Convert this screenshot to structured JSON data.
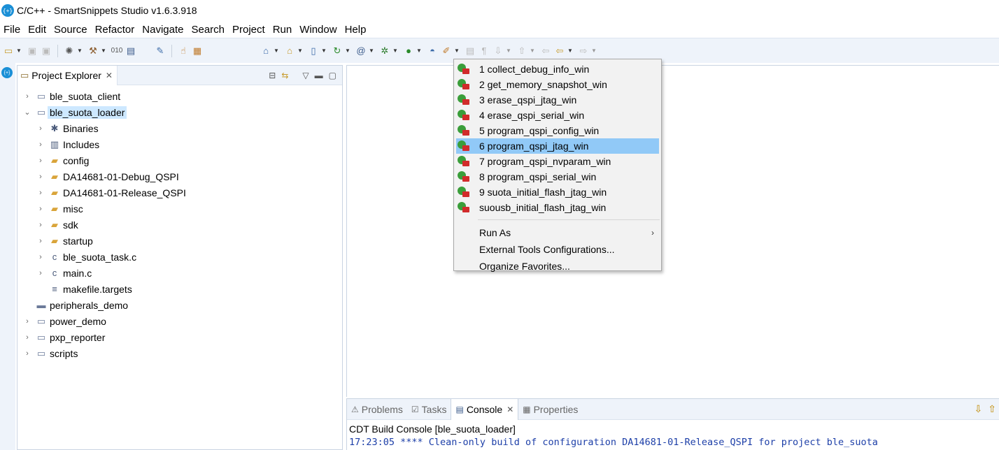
{
  "window": {
    "title": "C/C++ - SmartSnippets Studio v1.6.3.918"
  },
  "menubar": [
    "File",
    "Edit",
    "Source",
    "Refactor",
    "Navigate",
    "Search",
    "Project",
    "Run",
    "Window",
    "Help"
  ],
  "explorer": {
    "tab_label": "Project Explorer",
    "tree": [
      {
        "label": "ble_suota_client",
        "level": 0,
        "expander": "collapsed",
        "icon": "open-project-icon"
      },
      {
        "label": "ble_suota_loader",
        "level": 0,
        "expander": "expanded",
        "icon": "open-project-icon",
        "selected": true
      },
      {
        "label": "Binaries",
        "level": 1,
        "expander": "collapsed",
        "icon": "binaries-icon"
      },
      {
        "label": "Includes",
        "level": 1,
        "expander": "collapsed",
        "icon": "includes-icon"
      },
      {
        "label": "config",
        "level": 1,
        "expander": "collapsed",
        "icon": "folder-icon"
      },
      {
        "label": "DA14681-01-Debug_QSPI",
        "level": 1,
        "expander": "collapsed",
        "icon": "folder-icon"
      },
      {
        "label": "DA14681-01-Release_QSPI",
        "level": 1,
        "expander": "collapsed",
        "icon": "folder-icon"
      },
      {
        "label": "misc",
        "level": 1,
        "expander": "collapsed",
        "icon": "source-folder-icon"
      },
      {
        "label": "sdk",
        "level": 1,
        "expander": "collapsed",
        "icon": "source-folder-icon"
      },
      {
        "label": "startup",
        "level": 1,
        "expander": "collapsed",
        "icon": "source-folder-icon"
      },
      {
        "label": "ble_suota_task.c",
        "level": 1,
        "expander": "collapsed",
        "icon": "c-file-icon"
      },
      {
        "label": "main.c",
        "level": 1,
        "expander": "collapsed",
        "icon": "c-file-icon"
      },
      {
        "label": "makefile.targets",
        "level": 1,
        "expander": "none",
        "icon": "text-file-icon"
      },
      {
        "label": "peripherals_demo",
        "level": 0,
        "expander": "none",
        "icon": "closed-project-icon"
      },
      {
        "label": "power_demo",
        "level": 0,
        "expander": "collapsed",
        "icon": "open-project-icon"
      },
      {
        "label": "pxp_reporter",
        "level": 0,
        "expander": "collapsed",
        "icon": "open-project-icon"
      },
      {
        "label": "scripts",
        "level": 0,
        "expander": "collapsed",
        "icon": "open-project-icon"
      }
    ]
  },
  "external_tools_menu": {
    "items": [
      "1 collect_debug_info_win",
      "2 get_memory_snapshot_win",
      "3 erase_qspi_jtag_win",
      "4 erase_qspi_serial_win",
      "5 program_qspi_config_win",
      "6 program_qspi_jtag_win",
      "7 program_qspi_nvparam_win",
      "8 program_qspi_serial_win",
      "9 suota_initial_flash_jtag_win",
      "suousb_initial_flash_jtag_win"
    ],
    "highlighted_index": 5,
    "run_as": "Run As",
    "configurations": "External Tools Configurations...",
    "organize": "Organize Favorites..."
  },
  "console": {
    "tabs": [
      "Problems",
      "Tasks",
      "Console",
      "Properties"
    ],
    "active_tab": "Console",
    "title": "CDT Build Console [ble_suota_loader]",
    "line": "17:23:05 **** Clean-only build of configuration DA14681-01-Release_QSPI for project ble_suota"
  }
}
